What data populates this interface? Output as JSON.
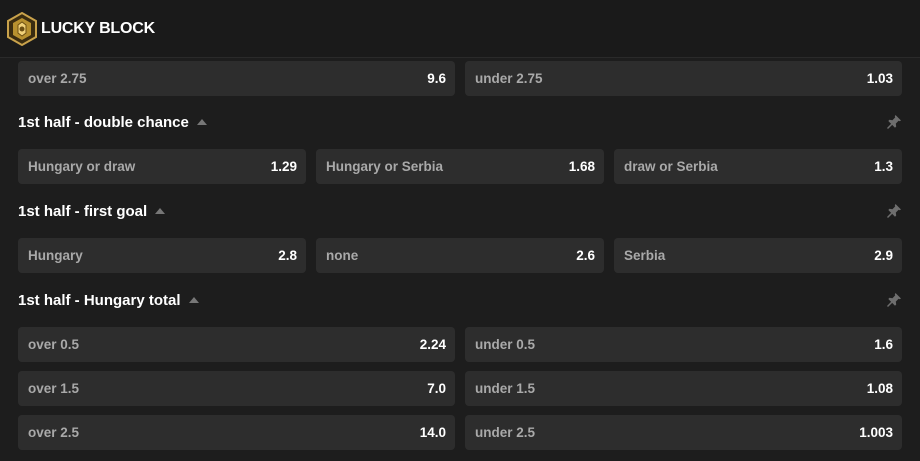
{
  "brand": {
    "name": "LUCKY BLOCK",
    "accent": "#c9a24b"
  },
  "icons": {
    "logo": "lucky-block-logo-icon",
    "pin": "pin-icon",
    "collapse": "caret-up-icon"
  },
  "top_row": [
    {
      "label": "over 2.75",
      "odds": "9.6"
    },
    {
      "label": "under 2.75",
      "odds": "1.03"
    }
  ],
  "sections": [
    {
      "title": "1st half - double chance",
      "options": [
        {
          "label": "Hungary or draw",
          "odds": "1.29"
        },
        {
          "label": "Hungary or Serbia",
          "odds": "1.68"
        },
        {
          "label": "draw or Serbia",
          "odds": "1.3"
        }
      ]
    },
    {
      "title": "1st half - first goal",
      "options": [
        {
          "label": "Hungary",
          "odds": "2.8"
        },
        {
          "label": "none",
          "odds": "2.6"
        },
        {
          "label": "Serbia",
          "odds": "2.9"
        }
      ]
    },
    {
      "title": "1st half - Hungary total",
      "rows": [
        [
          {
            "label": "over 0.5",
            "odds": "2.24"
          },
          {
            "label": "under 0.5",
            "odds": "1.6"
          }
        ],
        [
          {
            "label": "over 1.5",
            "odds": "7.0"
          },
          {
            "label": "under 1.5",
            "odds": "1.08"
          }
        ],
        [
          {
            "label": "over 2.5",
            "odds": "14.0"
          },
          {
            "label": "under 2.5",
            "odds": "1.003"
          }
        ]
      ]
    }
  ]
}
